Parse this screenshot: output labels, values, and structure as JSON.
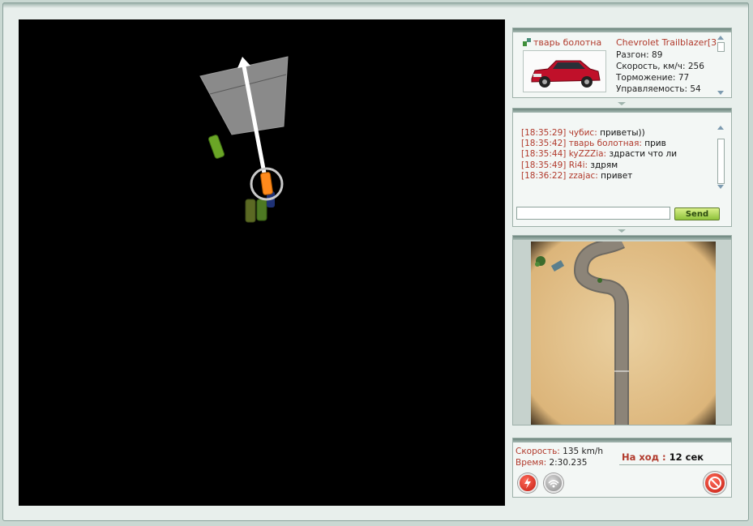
{
  "colors": {
    "accent_red": "#b13a2c",
    "send_green": "#8fc23b",
    "road": "#6e6a62",
    "sand": "#e3c48c",
    "player_car": "#ff8a1c",
    "rival_car": "#6aa526"
  },
  "car": {
    "driver": "тварь болотна",
    "model": "Chevrolet Trailblazer[3",
    "stats": [
      {
        "label": "Разгон",
        "value": "89"
      },
      {
        "label": "Скорость, км/ч",
        "value": "256"
      },
      {
        "label": "Торможение",
        "value": "77"
      },
      {
        "label": "Управляемость",
        "value": "54"
      }
    ]
  },
  "chat": {
    "messages": [
      {
        "time": "[18:35:29]",
        "nick": "чубис:",
        "text": "приветы))"
      },
      {
        "time": "[18:35:42]",
        "nick": "тварь болотная:",
        "text": "прив"
      },
      {
        "time": "[18:35:44]",
        "nick": "kyZZZia:",
        "text": "здрасти что ли"
      },
      {
        "time": "[18:35:49]",
        "nick": "Ri4i:",
        "text": "здрям"
      },
      {
        "time": "[18:36:22]",
        "nick": "zzajac:",
        "text": "привет"
      }
    ],
    "input_value": "",
    "send_label": "Send"
  },
  "status": {
    "speed_label": "Скорость:",
    "speed_value": "135 km/h",
    "time_label": "Время:",
    "time_value": "2:30.235",
    "turn_label": "На ход :",
    "turn_value": "12 сек"
  },
  "icons": {
    "boost": "lightning-icon",
    "signal": "wifi-icon",
    "quit": "no-entry-icon",
    "driver": "user-icon"
  }
}
